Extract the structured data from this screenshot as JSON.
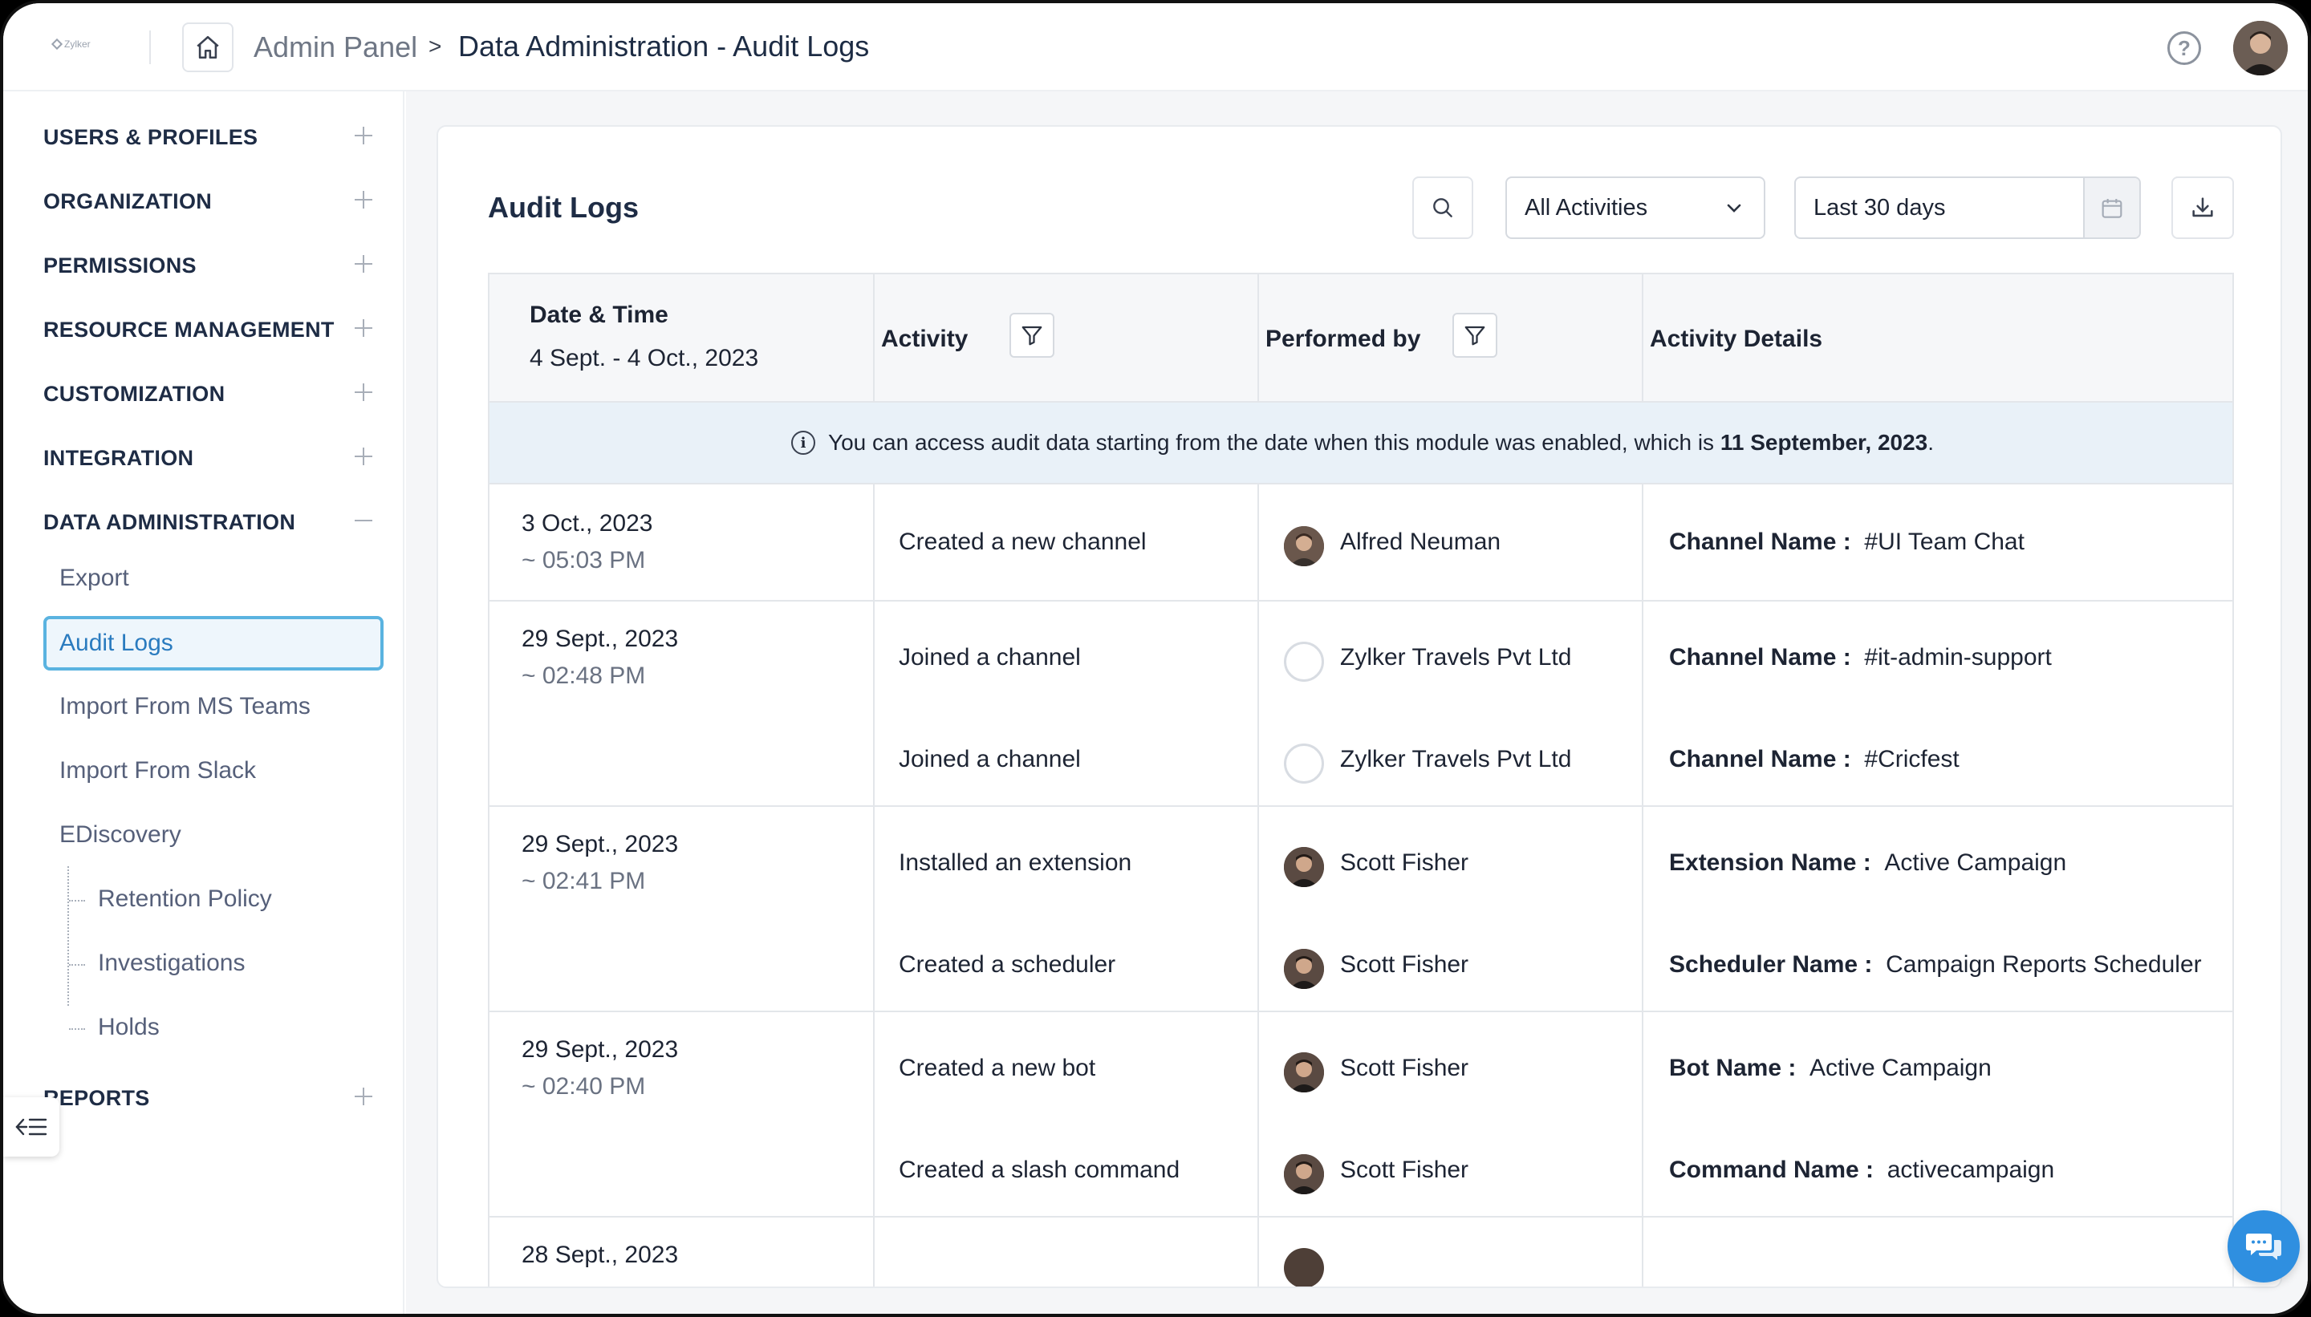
{
  "header": {
    "logo_text": "Zylker",
    "breadcrumb_root": "Admin Panel",
    "breadcrumb_sep": ">",
    "breadcrumb_current": "Data Administration - Audit Logs",
    "help_label": "?"
  },
  "sidebar": {
    "sections": [
      {
        "label": "USERS & PROFILES",
        "state": "collapsed"
      },
      {
        "label": "ORGANIZATION",
        "state": "collapsed"
      },
      {
        "label": "PERMISSIONS",
        "state": "collapsed"
      },
      {
        "label": "RESOURCE MANAGEMENT",
        "state": "collapsed"
      },
      {
        "label": "CUSTOMIZATION",
        "state": "collapsed"
      },
      {
        "label": "INTEGRATION",
        "state": "collapsed"
      },
      {
        "label": "DATA ADMINISTRATION",
        "state": "expanded"
      },
      {
        "label": "REPORTS",
        "state": "collapsed"
      }
    ],
    "items": [
      "Export",
      "Audit Logs",
      "Import From MS Teams",
      "Import From Slack",
      "EDiscovery"
    ],
    "ediscovery_items": [
      "Retention Policy",
      "Investigations",
      "Holds"
    ],
    "active_item": "Audit Logs"
  },
  "main": {
    "title": "Audit Logs",
    "activity_filter": "All Activities",
    "date_range": "Last 30 days",
    "columns": {
      "datetime": "Date & Time",
      "datetime_range": "4 Sept. - 4 Oct., 2023",
      "activity": "Activity",
      "performed_by": "Performed by",
      "details": "Activity Details"
    },
    "notice": {
      "text": "You can access audit data starting from the date when this module was enabled, which is",
      "date": "11 September, 2023",
      "end": "."
    },
    "groups": [
      {
        "date": "3 Oct., 2023",
        "time": "~ 05:03 PM",
        "entries": [
          {
            "activity": "Created a new channel",
            "user": "Alfred Neuman",
            "avatar": "photo",
            "detail_label": "Channel Name :",
            "detail_value": "#UI Team Chat"
          }
        ]
      },
      {
        "date": "29 Sept., 2023",
        "time": "~ 02:48 PM",
        "entries": [
          {
            "activity": "Joined a channel",
            "user": "Zylker Travels Pvt Ltd",
            "avatar": "blank",
            "detail_label": "Channel Name :",
            "detail_value": "#it-admin-support"
          },
          {
            "activity": "Joined a channel",
            "user": "Zylker Travels Pvt Ltd",
            "avatar": "blank",
            "detail_label": "Channel Name :",
            "detail_value": "#Cricfest"
          }
        ]
      },
      {
        "date": "29 Sept., 2023",
        "time": "~ 02:41 PM",
        "entries": [
          {
            "activity": "Installed an extension",
            "user": "Scott Fisher",
            "avatar": "photo",
            "detail_label": "Extension Name :",
            "detail_value": "Active Campaign"
          },
          {
            "activity": "Created a scheduler",
            "user": "Scott Fisher",
            "avatar": "photo",
            "detail_label": "Scheduler Name :",
            "detail_value": "Campaign Reports Scheduler"
          }
        ]
      },
      {
        "date": "29 Sept., 2023",
        "time": "~ 02:40 PM",
        "entries": [
          {
            "activity": "Created a new bot",
            "user": "Scott Fisher",
            "avatar": "photo",
            "detail_label": "Bot Name :",
            "detail_value": "Active Campaign"
          },
          {
            "activity": "Created a slash command",
            "user": "Scott Fisher",
            "avatar": "photo",
            "detail_label": "Command Name :",
            "detail_value": "activecampaign"
          }
        ]
      },
      {
        "date": "28 Sept., 2023",
        "time": "",
        "entries": []
      }
    ]
  },
  "colors": {
    "accent": "#2a7bbf",
    "active_border": "#5ab3e0",
    "notice_bg": "#e9f1f8",
    "chat_fab": "#2f8fe0"
  },
  "icons": [
    "home-icon",
    "help-icon",
    "search-icon",
    "chevron-down-icon",
    "calendar-icon",
    "download-icon",
    "filter-icon",
    "info-icon",
    "collapse-sidebar-icon",
    "chat-icon"
  ]
}
